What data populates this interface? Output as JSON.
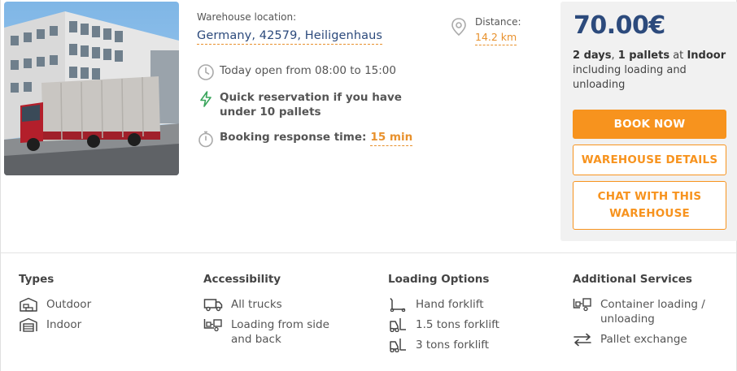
{
  "location": {
    "label": "Warehouse location:",
    "value": "Germany, 42579, Heiligenhaus"
  },
  "distance": {
    "label": "Distance:",
    "value": "14.2 km"
  },
  "info": {
    "hours": "Today open from 08:00 to 15:00",
    "quick_reservation": "Quick reservation if you have under 10 pallets",
    "response_label": "Booking response time:",
    "response_value": "15 min"
  },
  "pricing": {
    "price": "70.00€",
    "days": "2 days",
    "pallets": "1 pallets",
    "at_word": "at",
    "storage": "Indoor",
    "extra": "including loading and unloading"
  },
  "buttons": {
    "book": "BOOK NOW",
    "details": "WAREHOUSE DETAILS",
    "chat": "CHAT WITH THIS WAREHOUSE"
  },
  "features": {
    "types": {
      "title": "Types",
      "items": [
        {
          "label": "Outdoor",
          "icon": "outdoor-warehouse-icon"
        },
        {
          "label": "Indoor",
          "icon": "indoor-warehouse-icon"
        }
      ]
    },
    "accessibility": {
      "title": "Accessibility",
      "items": [
        {
          "label": "All trucks",
          "icon": "truck-icon"
        },
        {
          "label": "Loading from side and back",
          "icon": "loading-icon"
        }
      ]
    },
    "loading": {
      "title": "Loading Options",
      "items": [
        {
          "label": "Hand forklift",
          "icon": "hand-forklift-icon"
        },
        {
          "label": "1.5 tons forklift",
          "icon": "forklift-icon"
        },
        {
          "label": "3 tons forklift",
          "icon": "forklift-icon"
        }
      ]
    },
    "services": {
      "title": "Additional Services",
      "items": [
        {
          "label": "Container loading / unloading",
          "icon": "container-loading-icon"
        },
        {
          "label": "Pallet exchange",
          "icon": "exchange-arrows-icon"
        }
      ]
    }
  },
  "colors": {
    "accent": "#f7931e",
    "brand_blue": "#2c4a7c",
    "panel_bg": "#f1f1f1",
    "lightning_green": "#3aa55c"
  }
}
